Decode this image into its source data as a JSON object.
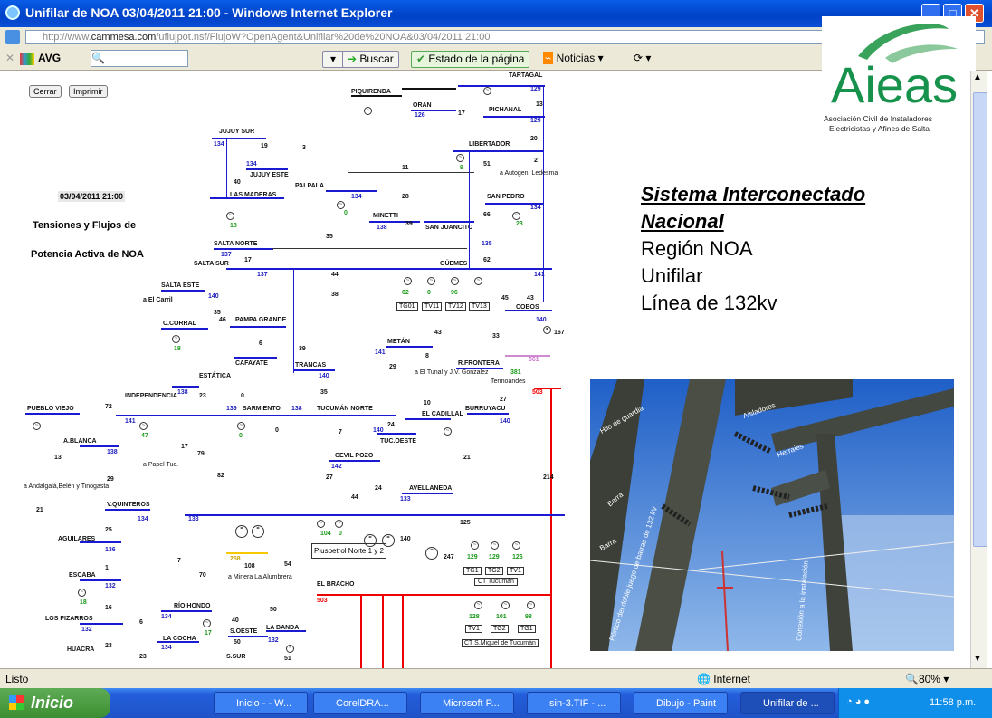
{
  "window": {
    "title": "Unifilar de NOA 03/04/2011 21:00 - Windows Internet Explorer"
  },
  "address": {
    "url_prefix": "http://www.",
    "url_domain": "cammesa.com",
    "url_rest": "/uflujpot.nsf/FlujoW?OpenAgent&Unifilar%20de%20NOA&03/04/2011 21:00"
  },
  "toolbar": {
    "avg": "AVG",
    "search_btn": "Buscar",
    "page_status": "Estado de la página",
    "news": "Noticias"
  },
  "diagram": {
    "close_btn": "Cerrar",
    "print_btn": "Imprimir",
    "date": "03/04/2011 21:00",
    "heading1": "Tensiones y Flujos de",
    "heading2": "Potencia Activa de NOA",
    "nodes": {
      "tartagal": "TARTAGAL",
      "piquirenda": "PIQUIRENDA",
      "oran": "ORAN",
      "pichanal": "PICHANAL",
      "jujuy_sur": "JUJUY SUR",
      "jujuy_este": "JUJUY ESTE",
      "libertador": "LIBERTADOR",
      "autogen": "a Autogen. Ledesma",
      "palpala": "PALPALA",
      "las_maderas": "LAS MADERAS",
      "minetti": "MINETTI",
      "san_juancito": "SAN JUANCITO",
      "san_pedro": "SAN PEDRO",
      "salta_norte": "SALTA NORTE",
      "salta_sur": "SALTA SUR",
      "guemes": "GÜEMES",
      "salta_este": "SALTA ESTE",
      "el_carril": "a El Carril",
      "c_corral": "C.CORRAL",
      "pampa_grande": "PAMPA GRANDE",
      "cobos": "COBOS",
      "cafayate": "CAFAYATE",
      "trancas": "TRANCAS",
      "metan": "METÁN",
      "estatica": "ESTÁTICA",
      "r_frontera": "R.FRONTERA",
      "el_tunal": "a El Tunal y J.V. Gonzalez",
      "termoandes": "Termoandes",
      "independencia": "INDEPENDENCIA",
      "sarmiento": "SARMIENTO",
      "tucuman_norte": "TUCUMÁN NORTE",
      "pueblo_viejo": "PUEBLO VIEJO",
      "el_cadillal": "EL CADILLAL",
      "burruyacu": "BURRUYACU",
      "a_blanca": "A.BLANCA",
      "tuc_oeste": "TUC.OESTE",
      "papel_tuc": "a Papel Tuc.",
      "cevil_pozo": "CEVIL POZO",
      "andalgala": "a Andalgalá,Belén y Tinogasta",
      "avellaneda": "AVELLANEDA",
      "v_quintero": "V.QUINTEROS",
      "aguilares": "AGUILARES",
      "pluspetrol": "Pluspetrol Norte 1 y 2",
      "escaba": "ESCABA",
      "minera": "a Minera La Alumbrera",
      "el bracho": "EL BRACHO",
      "ct_tucuman": "CT Tucumán",
      "rio_hondo": "RÍO HONDO",
      "los_pizarros": "LOS PIZARROS",
      "huacra": "HUACRA",
      "la_cocha": "LA COCHA",
      "s_oeste": "S.OESTE",
      "la_banda": "LA BANDA",
      "s_sur": "S.SUR",
      "ct_smt": "CT S.Miguel de Tucumán"
    },
    "units": [
      "TG01",
      "TV11",
      "TV12",
      "TV13",
      "TG1",
      "TG2",
      "TV1",
      "TV1",
      "TG2",
      "TG1"
    ],
    "voltages": [
      "129",
      "129",
      "126",
      "134",
      "134",
      "134",
      "138",
      "134",
      "135",
      "137",
      "137",
      "141",
      "140",
      "140",
      "140",
      "141",
      "140",
      "138",
      "139",
      "141",
      "138",
      "138",
      "140",
      "140",
      "142",
      "133",
      "133",
      "134",
      "136",
      "132",
      "134",
      "132",
      "561",
      "503",
      "503",
      "258"
    ],
    "flows": [
      "13",
      "19",
      "20",
      "17",
      "2",
      "3",
      "51",
      "40",
      "11",
      "28",
      "39",
      "66",
      "35",
      "17",
      "44",
      "38",
      "62",
      "45",
      "43",
      "35",
      "46",
      "6",
      "39",
      "33",
      "167",
      "43",
      "8",
      "29",
      "381",
      "35",
      "23",
      "0",
      "27",
      "72",
      "10",
      "13",
      "24",
      "17",
      "79",
      "7",
      "21",
      "29",
      "82",
      "27",
      "44",
      "24",
      "21",
      "214",
      "125",
      "104",
      "0",
      "140",
      "247",
      "129",
      "129",
      "126",
      "25",
      "108",
      "54",
      "7",
      "1",
      "70",
      "18",
      "16",
      "40",
      "6",
      "50",
      "23",
      "18",
      "51",
      "128",
      "101",
      "98",
      "15",
      "89",
      "0",
      "62",
      "0",
      "96",
      "9",
      "0",
      "18",
      "23",
      "47",
      "0",
      "0",
      "17"
    ],
    "accent_blue": "#1a1ad0",
    "accent_red": "#e00000"
  },
  "panel": {
    "logo_text": "Aieas",
    "logo_sub1": "Asociación Civil de Instaladores",
    "logo_sub2": "Electricistas y Afines de Salta",
    "title_line1": "Sistema Interconectado",
    "title_line2": "Nacional",
    "line3": "Región NOA",
    "line4": "Unifilar",
    "line5": "Línea de 132kv",
    "photo_labels": {
      "hilo": "Hilo de guardia",
      "aisladores": "Aisladores",
      "herrajes": "Herrajes",
      "barra1": "Barra",
      "barra2": "Barra",
      "portico": "Pórtico del doble juego de barras de 132 kV",
      "conexion": "Conexión a la instalación"
    }
  },
  "status": {
    "left": "Listo",
    "zone": "Internet",
    "zoom": "80%"
  },
  "taskbar": {
    "start": "Inicio",
    "tasks": [
      "Inicio - - W...",
      "CorelDRA...",
      "Microsoft P...",
      "sin-3.TIF - ...",
      "Dibujo - Paint",
      "Unifilar de ..."
    ],
    "clock": "11:58 p.m."
  }
}
